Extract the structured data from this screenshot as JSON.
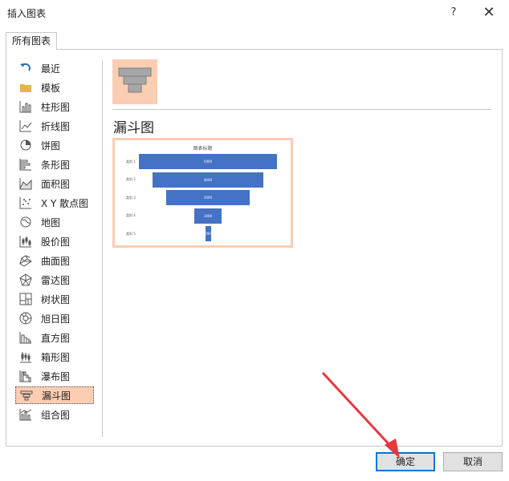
{
  "window": {
    "title": "插入图表",
    "help_label": "?",
    "close_label": "✕"
  },
  "tabs": [
    {
      "label": "所有图表"
    }
  ],
  "chart_types": [
    {
      "label": "最近",
      "icon": "recent-icon"
    },
    {
      "label": "模板",
      "icon": "folder-icon"
    },
    {
      "label": "柱形图",
      "icon": "column-chart-icon"
    },
    {
      "label": "折线图",
      "icon": "line-chart-icon"
    },
    {
      "label": "饼图",
      "icon": "pie-chart-icon"
    },
    {
      "label": "条形图",
      "icon": "bar-chart-icon"
    },
    {
      "label": "面积图",
      "icon": "area-chart-icon"
    },
    {
      "label": "X Y 散点图",
      "icon": "scatter-chart-icon"
    },
    {
      "label": "地图",
      "icon": "map-chart-icon"
    },
    {
      "label": "股价图",
      "icon": "stock-chart-icon"
    },
    {
      "label": "曲面图",
      "icon": "surface-chart-icon"
    },
    {
      "label": "雷达图",
      "icon": "radar-chart-icon"
    },
    {
      "label": "树状图",
      "icon": "treemap-chart-icon"
    },
    {
      "label": "旭日图",
      "icon": "sunburst-chart-icon"
    },
    {
      "label": "直方图",
      "icon": "histogram-chart-icon"
    },
    {
      "label": "箱形图",
      "icon": "box-whisker-chart-icon"
    },
    {
      "label": "瀑布图",
      "icon": "waterfall-chart-icon"
    },
    {
      "label": "漏斗图",
      "icon": "funnel-chart-icon",
      "selected": true
    },
    {
      "label": "组合图",
      "icon": "combo-chart-icon"
    }
  ],
  "selected_type": {
    "title": "漏斗图"
  },
  "preview": {
    "chart_title": "图表标题",
    "categories": [
      "类别 1",
      "类别 2",
      "类别 3",
      "类别 4",
      "类别 5"
    ],
    "value_labels": [
      "5000",
      "4000",
      "3000",
      "1000",
      "200"
    ]
  },
  "chart_data": {
    "type": "bar",
    "subtype": "funnel",
    "title": "图表标题",
    "categories": [
      "类别 1",
      "类别 2",
      "类别 3",
      "类别 4",
      "类别 5"
    ],
    "values": [
      5000,
      4000,
      3000,
      1000,
      200
    ],
    "color": "#4472c4"
  },
  "buttons": {
    "ok": "确定",
    "cancel": "取消"
  },
  "colors": {
    "selection": "#fbcdb3",
    "bar": "#4472c4",
    "arrow": "#e8383d"
  }
}
